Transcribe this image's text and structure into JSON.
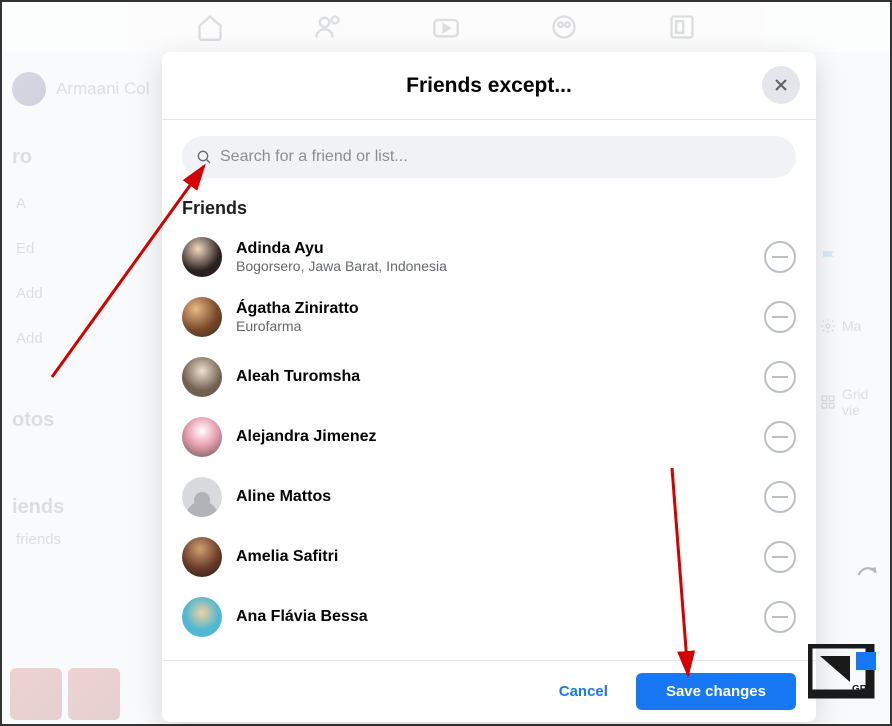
{
  "background": {
    "profile_name": "Armaani Col",
    "section_intro": "ro",
    "items": [
      "A",
      "Ed",
      "Add",
      "Add"
    ],
    "photos_label": "otos",
    "friends_label": "iends",
    "friends_sub": "friends",
    "right_action_flag": "",
    "right_action_manage": "Ma",
    "right_action_grid": "Grid vie",
    "right_picture": "Picture"
  },
  "modal": {
    "title": "Friends except...",
    "search_placeholder": "Search for a friend or list...",
    "section_label": "Friends",
    "cancel_label": "Cancel",
    "save_label": "Save changes"
  },
  "friends": [
    {
      "name": "Adinda Ayu",
      "sub": "Bogorsero, Jawa Barat, Indonesia"
    },
    {
      "name": "Ágatha Ziniratto",
      "sub": "Eurofarma"
    },
    {
      "name": "Aleah Turomsha",
      "sub": ""
    },
    {
      "name": "Alejandra Jimenez",
      "sub": ""
    },
    {
      "name": "Aline Mattos",
      "sub": ""
    },
    {
      "name": "Amelia Safitri",
      "sub": ""
    },
    {
      "name": "Ana Flávia Bessa",
      "sub": ""
    }
  ]
}
